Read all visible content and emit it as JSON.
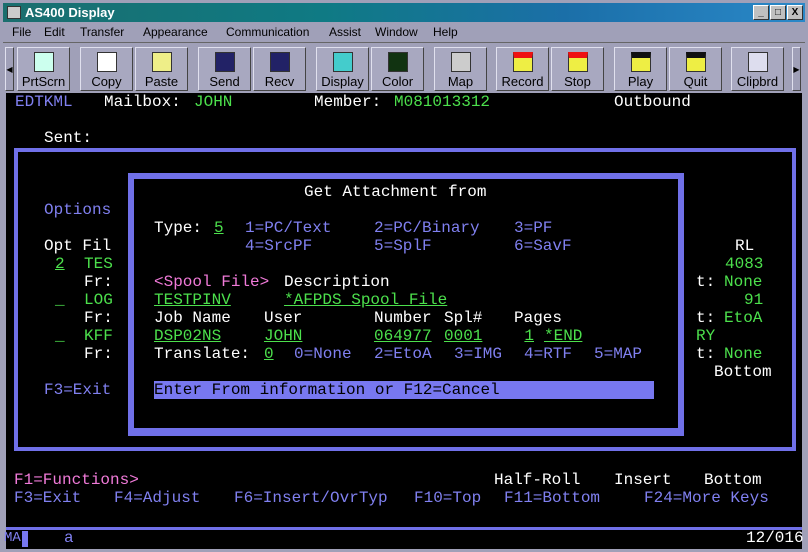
{
  "window": {
    "title": "AS400 Display",
    "controls": [
      "_",
      "□",
      "X"
    ]
  },
  "menu": [
    "File",
    "Edit",
    "Transfer",
    "Appearance",
    "Communication",
    "Assist",
    "Window",
    "Help"
  ],
  "toolbar": [
    {
      "label": "PrtScrn",
      "icon": "printer-icon"
    },
    {
      "label": "Copy",
      "icon": "copy-icon"
    },
    {
      "label": "Paste",
      "icon": "paste-icon"
    },
    {
      "label": "Send",
      "icon": "send-icon"
    },
    {
      "label": "Recv",
      "icon": "receive-icon"
    },
    {
      "label": "Display",
      "icon": "display-icon"
    },
    {
      "label": "Color",
      "icon": "color-icon"
    },
    {
      "label": "Map",
      "icon": "map-icon"
    },
    {
      "label": "Record",
      "icon": "record-icon"
    },
    {
      "label": "Stop",
      "icon": "stop-icon"
    },
    {
      "label": "Play",
      "icon": "play-icon"
    },
    {
      "label": "Quit",
      "icon": "quit-icon"
    },
    {
      "label": "Clipbrd",
      "icon": "clipboard-icon"
    }
  ],
  "header": {
    "program": "EDTKML",
    "mailbox_label": "Mailbox:",
    "mailbox": "JOHN",
    "member_label": "Member:",
    "member": "M081013312",
    "direction": "Outbound",
    "sent_label": "Sent:"
  },
  "left_panel": {
    "options": "Options",
    "cols": "Opt Fil",
    "rows": [
      {
        "opt": "2",
        "file": "TES",
        "fr": "Fr:"
      },
      {
        "opt": "_",
        "file": "LOG",
        "fr": "Fr:"
      },
      {
        "opt": "_",
        "file": "KFF",
        "fr": "Fr:"
      }
    ],
    "exit": "F3=Exit"
  },
  "right_panel": {
    "col": "RL",
    "v1": "4083",
    "t": "t:",
    "n1": "None",
    "v2": "91",
    "n2": "EtoA",
    "v3": "RY",
    "n3": "None",
    "bottom": "Bottom"
  },
  "dialog": {
    "title": "Get Attachment from",
    "type_label": "Type:",
    "type_value": "5",
    "type_options": [
      "1=PC/Text",
      "2=PC/Binary",
      "3=PF",
      "4=SrcPF",
      "5=SplF",
      "6=SavF"
    ],
    "section": "<Spool File>",
    "desc_label": "Description",
    "file": "TESTPINV",
    "description": "*AFPDS Spool File",
    "cols": [
      "Job Name",
      "User",
      "Number",
      "Spl#",
      "Pages"
    ],
    "job": "DSP02NS",
    "user": "JOHN",
    "number": "064977",
    "spl": "0001",
    "pages": "1",
    "pages_end": "*END",
    "translate_label": "Translate:",
    "translate_value": "0",
    "translate_options": [
      "0=None",
      "2=EtoA",
      "3=IMG",
      "4=RTF",
      "5=MAP"
    ],
    "message": "Enter From information or F12=Cancel"
  },
  "footer": {
    "functions": "F1=Functions>",
    "half_roll": "Half-Roll",
    "insert": "Insert",
    "bottom": "Bottom",
    "keys": [
      "F3=Exit",
      "F4=Adjust",
      "F6=Insert/OvrTyp",
      "F10=Top",
      "F11=Bottom",
      "F24=More Keys"
    ]
  },
  "status": {
    "mode": "MA",
    "input": "a",
    "position": "12/016"
  },
  "colors": {
    "green": "#4ce04c",
    "blue": "#8080f0",
    "pink": "#f07ad8",
    "frame": "#7070e8"
  }
}
